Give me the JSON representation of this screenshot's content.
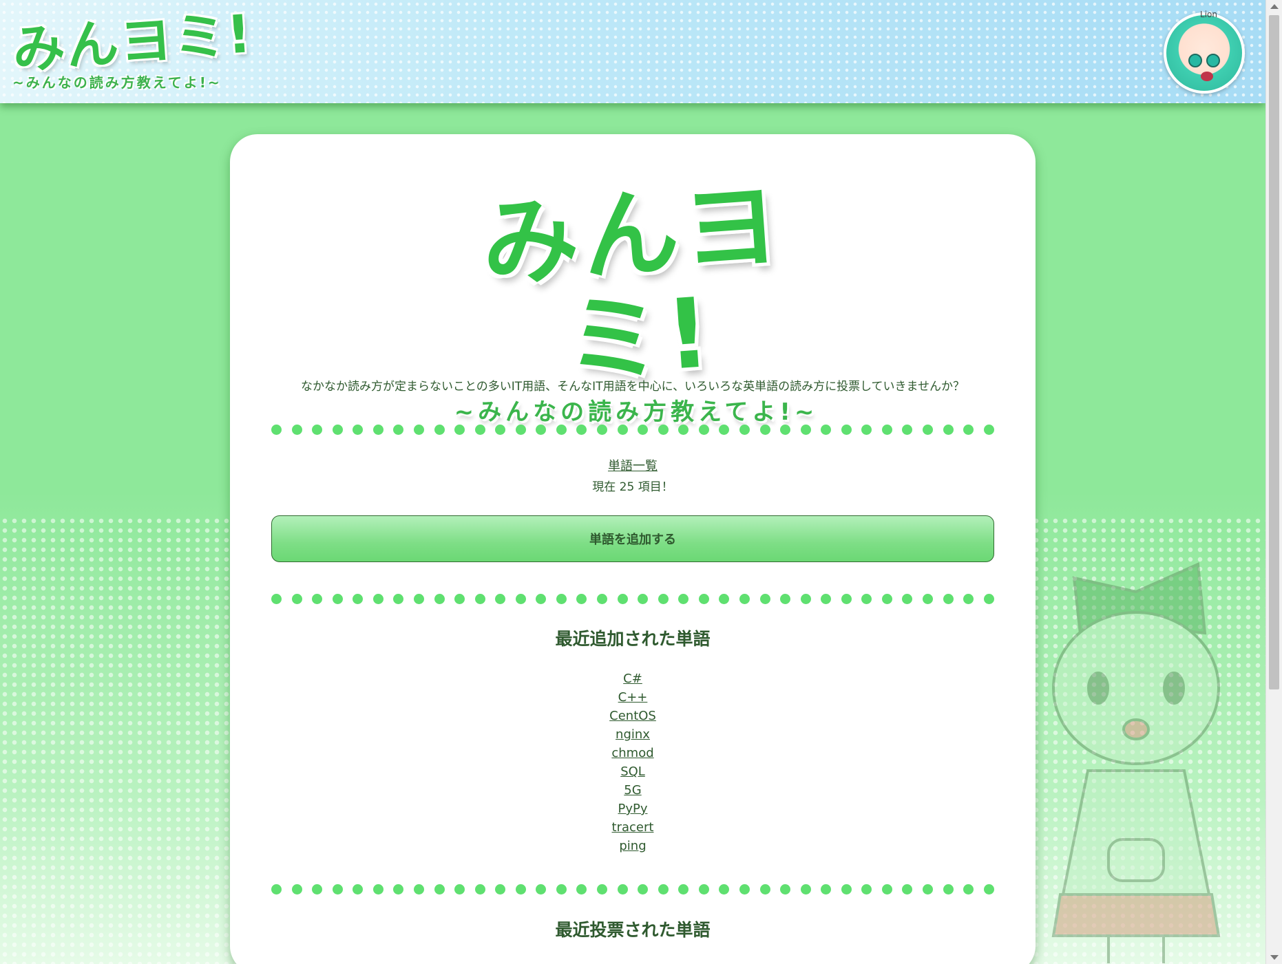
{
  "header": {
    "logo_main": "みんヨミ!",
    "logo_sub": "~みんなの読み方教えてよ!~",
    "avatar_tag": "Lion"
  },
  "card": {
    "logo_main": "みんヨミ!",
    "logo_sub": "~みんなの読み方教えてよ!~",
    "intro": "なかなか読み方が定まらないことの多いIT用語、そんなIT用語を中心に、いろいろな英単語の読み方に投票していきませんか？",
    "word_list_link": "単語一覧",
    "count_text": "現在 25 項目！",
    "add_button": "単語を追加する",
    "recent_added_title": "最近追加された単語",
    "recent_added": [
      "C#",
      "C++",
      "CentOS",
      "nginx",
      "chmod",
      "SQL",
      "5G",
      "PyPy",
      "tracert",
      "ping"
    ],
    "recent_voted_title": "最近投票された単語"
  },
  "colors": {
    "background": "#8ee89a",
    "accent": "#36c04a",
    "dot": "#5fe070",
    "text": "#2f5a2f"
  }
}
